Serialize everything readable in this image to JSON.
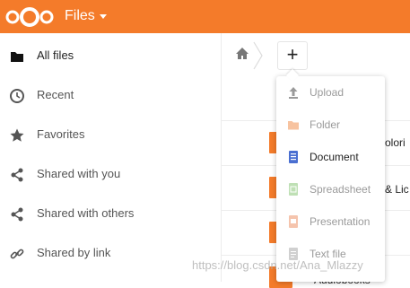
{
  "header": {
    "app_title": "Files",
    "accent_color": "#f47b2a"
  },
  "sidebar": {
    "items": [
      {
        "label": "All files",
        "icon": "folder-icon"
      },
      {
        "label": "Recent",
        "icon": "clock-icon"
      },
      {
        "label": "Favorites",
        "icon": "star-icon"
      },
      {
        "label": "Shared with you",
        "icon": "share-icon"
      },
      {
        "label": "Shared with others",
        "icon": "share-icon"
      },
      {
        "label": "Shared by link",
        "icon": "link-icon"
      }
    ]
  },
  "breadcrumb": {
    "new_button_label": "+"
  },
  "files": {
    "rows": [
      {
        "name": "olori"
      },
      {
        "name": "& Lic"
      },
      {
        "name": ""
      },
      {
        "name": "Audiobooks"
      }
    ]
  },
  "new_menu": {
    "items": [
      {
        "label": "Upload",
        "icon": "upload-icon"
      },
      {
        "label": "Folder",
        "icon": "folder-icon"
      },
      {
        "label": "Document",
        "icon": "document-icon"
      },
      {
        "label": "Spreadsheet",
        "icon": "spreadsheet-icon"
      },
      {
        "label": "Presentation",
        "icon": "presentation-icon"
      },
      {
        "label": "Text file",
        "icon": "text-file-icon"
      }
    ]
  },
  "watermark": {
    "text": "https://blog.csdn.net/Ana_Mlazzy"
  }
}
